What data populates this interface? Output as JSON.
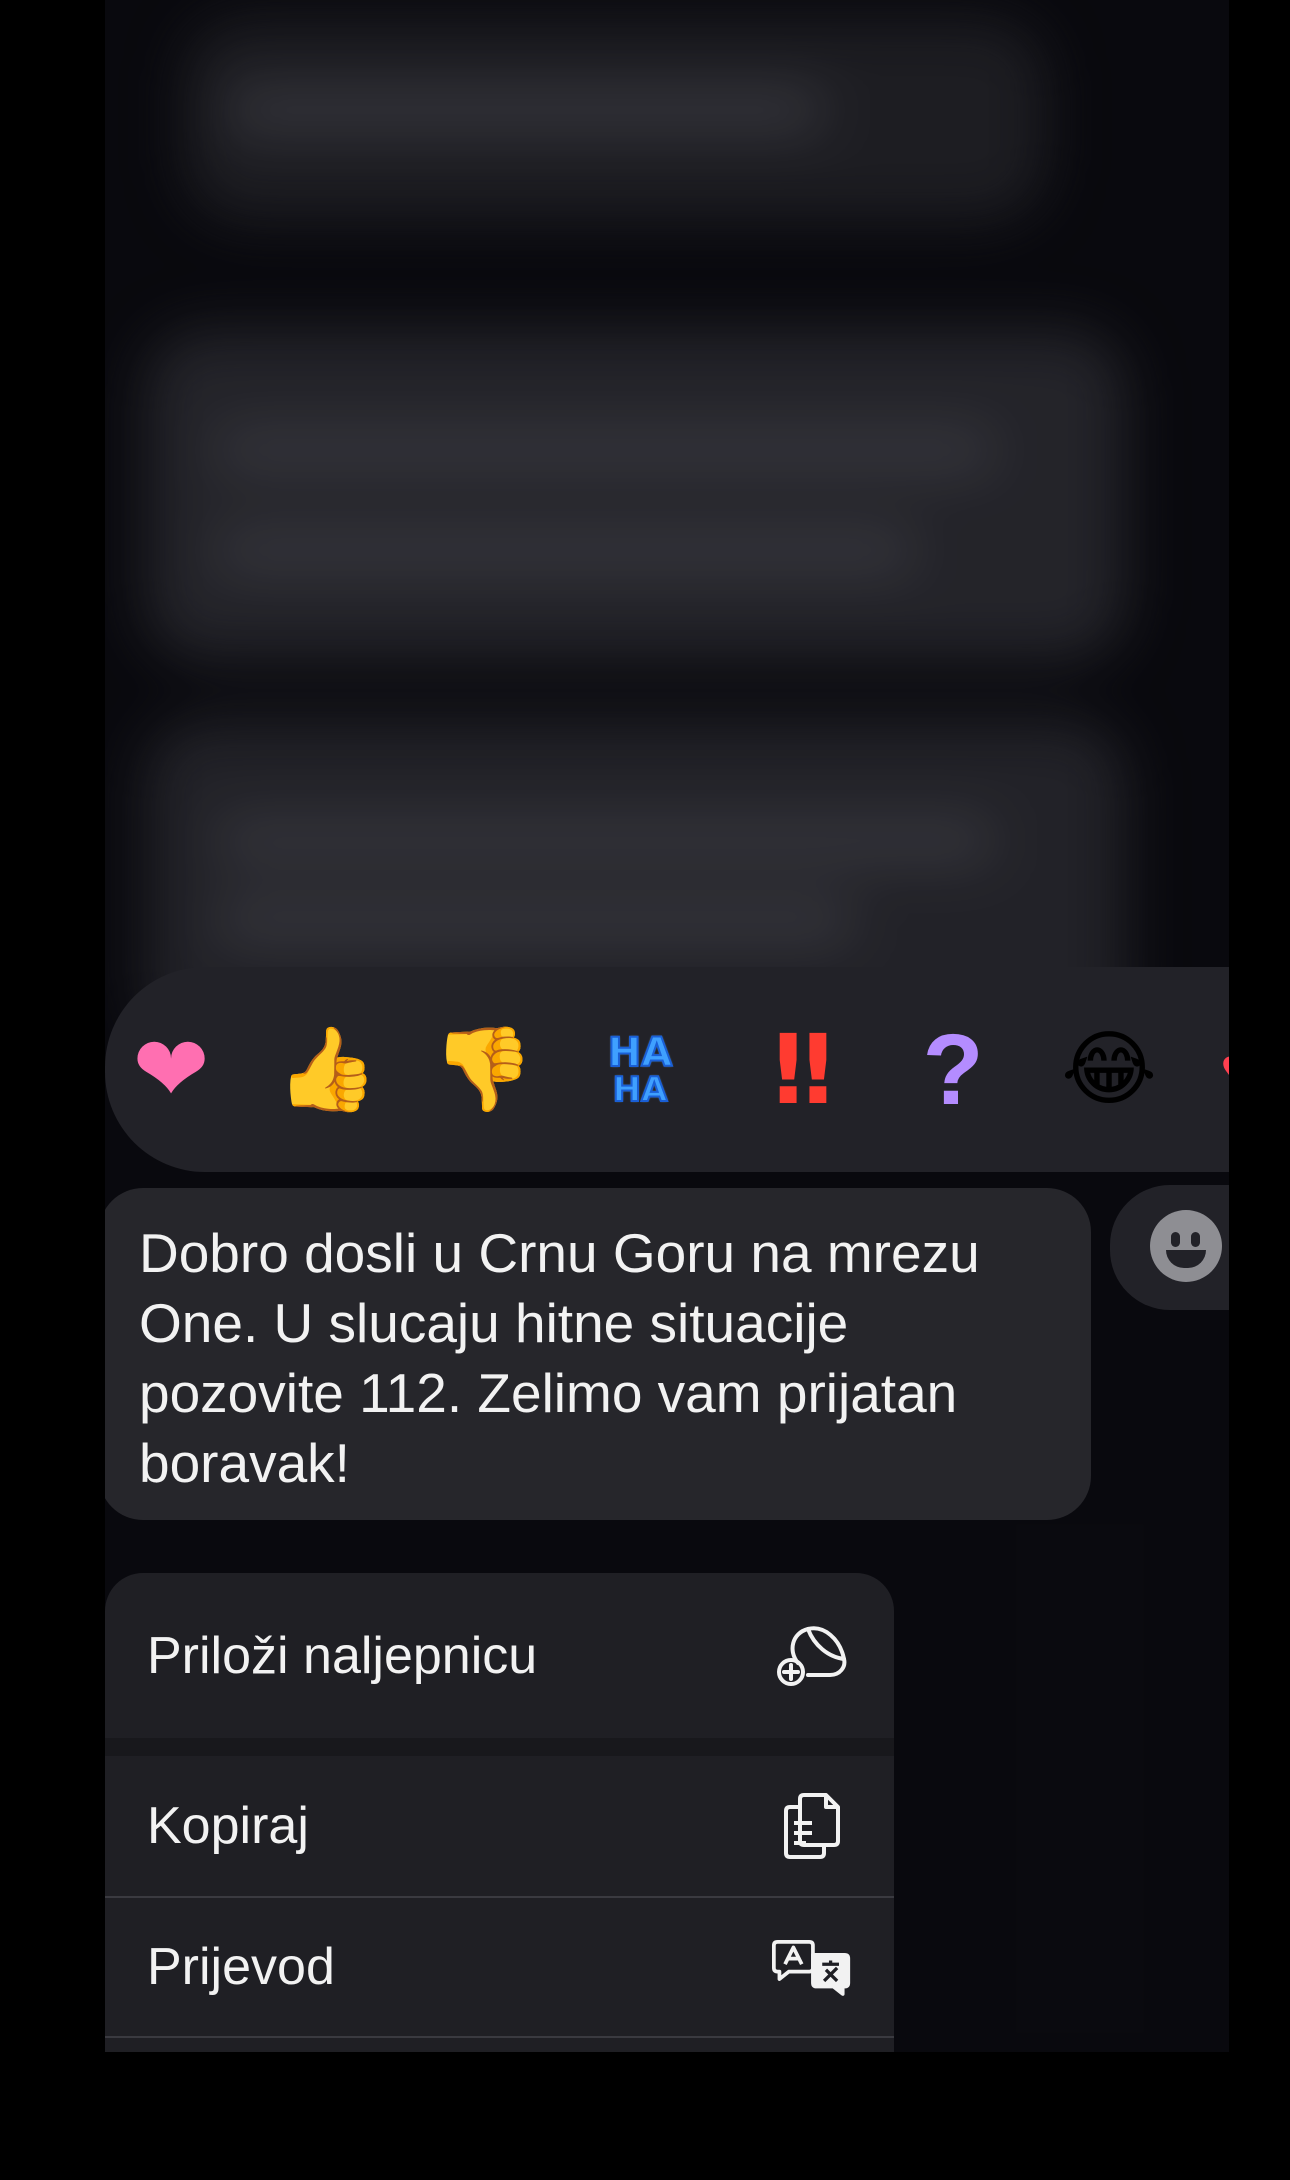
{
  "reactions": [
    {
      "name": "heart",
      "glyph": "❤"
    },
    {
      "name": "thumbs-up",
      "glyph": "👍"
    },
    {
      "name": "thumbs-down",
      "glyph": "👎"
    },
    {
      "name": "haha",
      "lines": [
        "HA",
        "HA"
      ]
    },
    {
      "name": "exclamation",
      "glyph": "!!"
    },
    {
      "name": "question",
      "glyph": "?"
    },
    {
      "name": "laugh",
      "glyph": "😂"
    },
    {
      "name": "more",
      "glyph": "♥"
    }
  ],
  "message": {
    "text": "Dobro dosli u Crnu Goru na mrezu One. U slucaju hitne situacije pozovite 112. Zelimo vam prijatan boravak!"
  },
  "menu": {
    "items": [
      {
        "label": "Priloži naljepnicu",
        "icon": "sticker-add-icon"
      },
      {
        "label": "Kopiraj",
        "icon": "copy-icon"
      },
      {
        "label": "Prijevod",
        "icon": "translate-icon"
      }
    ]
  },
  "colors": {
    "background": "#000000",
    "bubble": "#26262b",
    "menu": "#1f1f24",
    "text": "#f2f2f2"
  }
}
